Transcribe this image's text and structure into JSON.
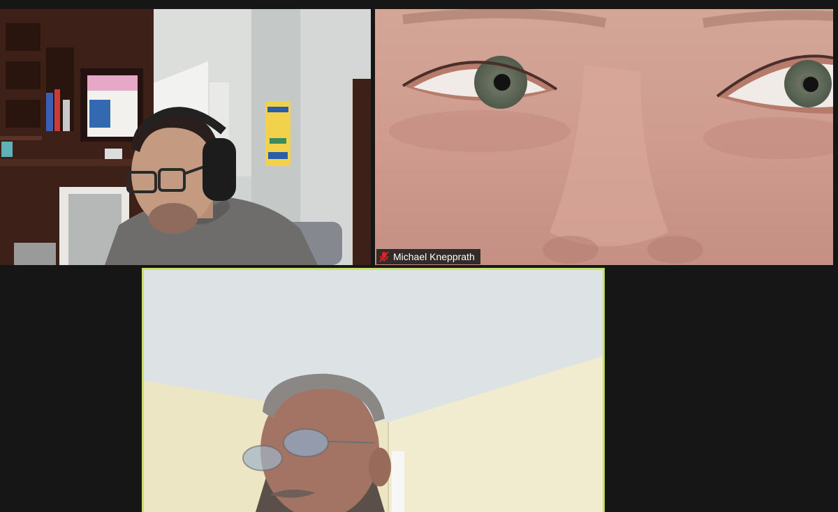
{
  "meeting": {
    "participants": [
      {
        "name": "",
        "muted": false,
        "speaking": false
      },
      {
        "name": "Michael Knepprath",
        "muted": true,
        "speaking": false
      },
      {
        "name": "",
        "muted": false,
        "speaking": true
      }
    ]
  },
  "colors": {
    "background": "#161616",
    "active_speaker_border": "#c8e06a",
    "muted_icon": "#e02424"
  },
  "icons": {
    "muted": "mic-muted-icon"
  }
}
